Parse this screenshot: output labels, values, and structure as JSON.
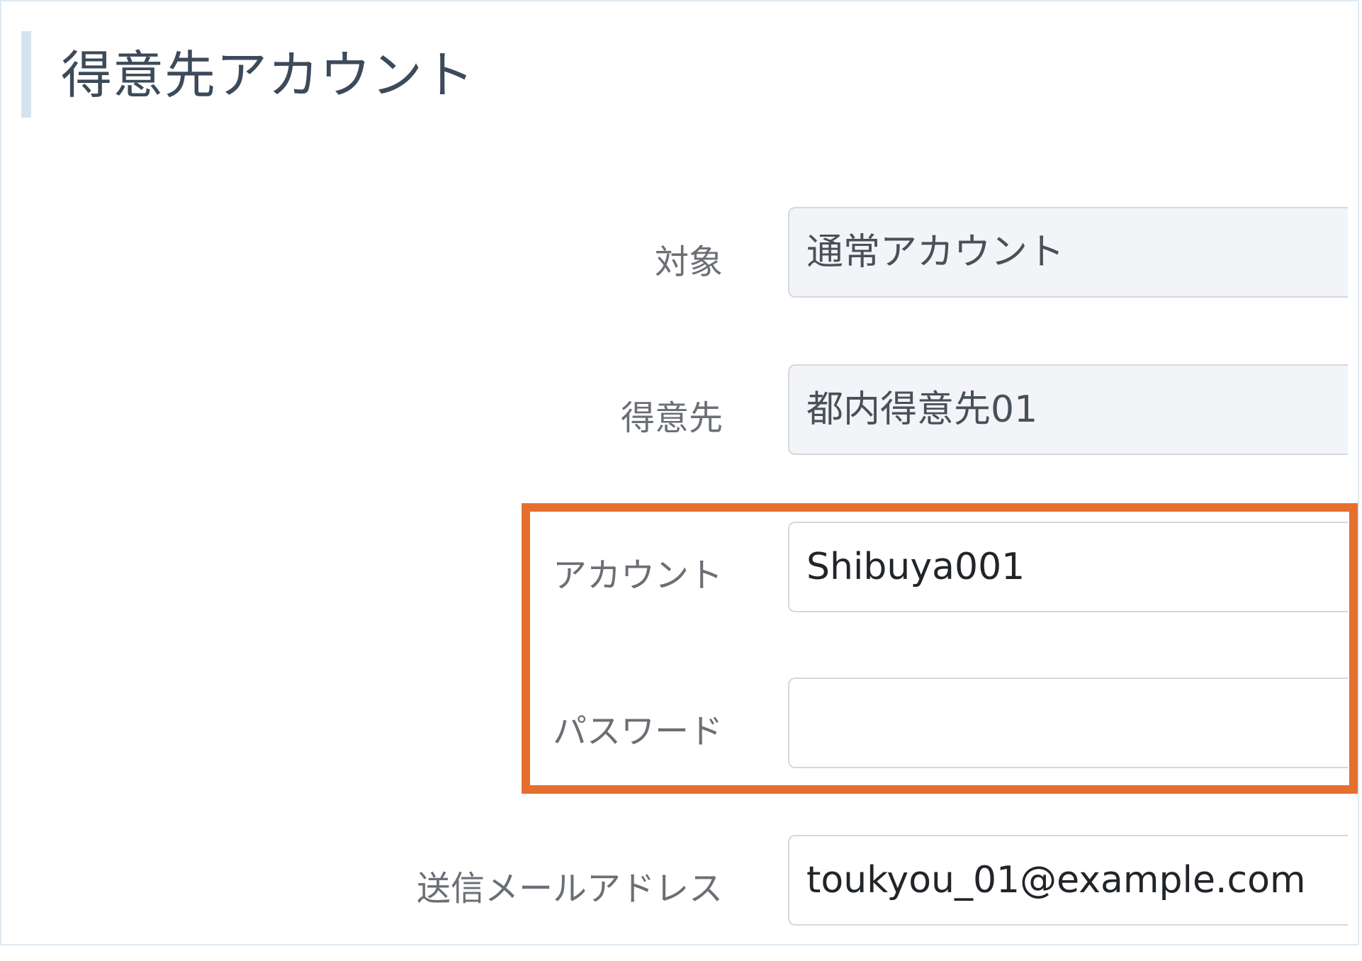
{
  "page": {
    "title": "得意先アカウント"
  },
  "form": {
    "target_label": "対象",
    "target_value": "通常アカウント",
    "customer_label": "得意先",
    "customer_value": "都内得意先01",
    "account_label": "アカウント",
    "account_value": "Shibuya001",
    "password_label": "パスワード",
    "password_value": "",
    "email_label": "送信メールアドレス",
    "email_value": "toukyou_01@example.com"
  },
  "colors": {
    "highlight": "#e46f2e",
    "title_accent": "#d5e3ee",
    "readonly_bg": "#f2f4f7"
  }
}
